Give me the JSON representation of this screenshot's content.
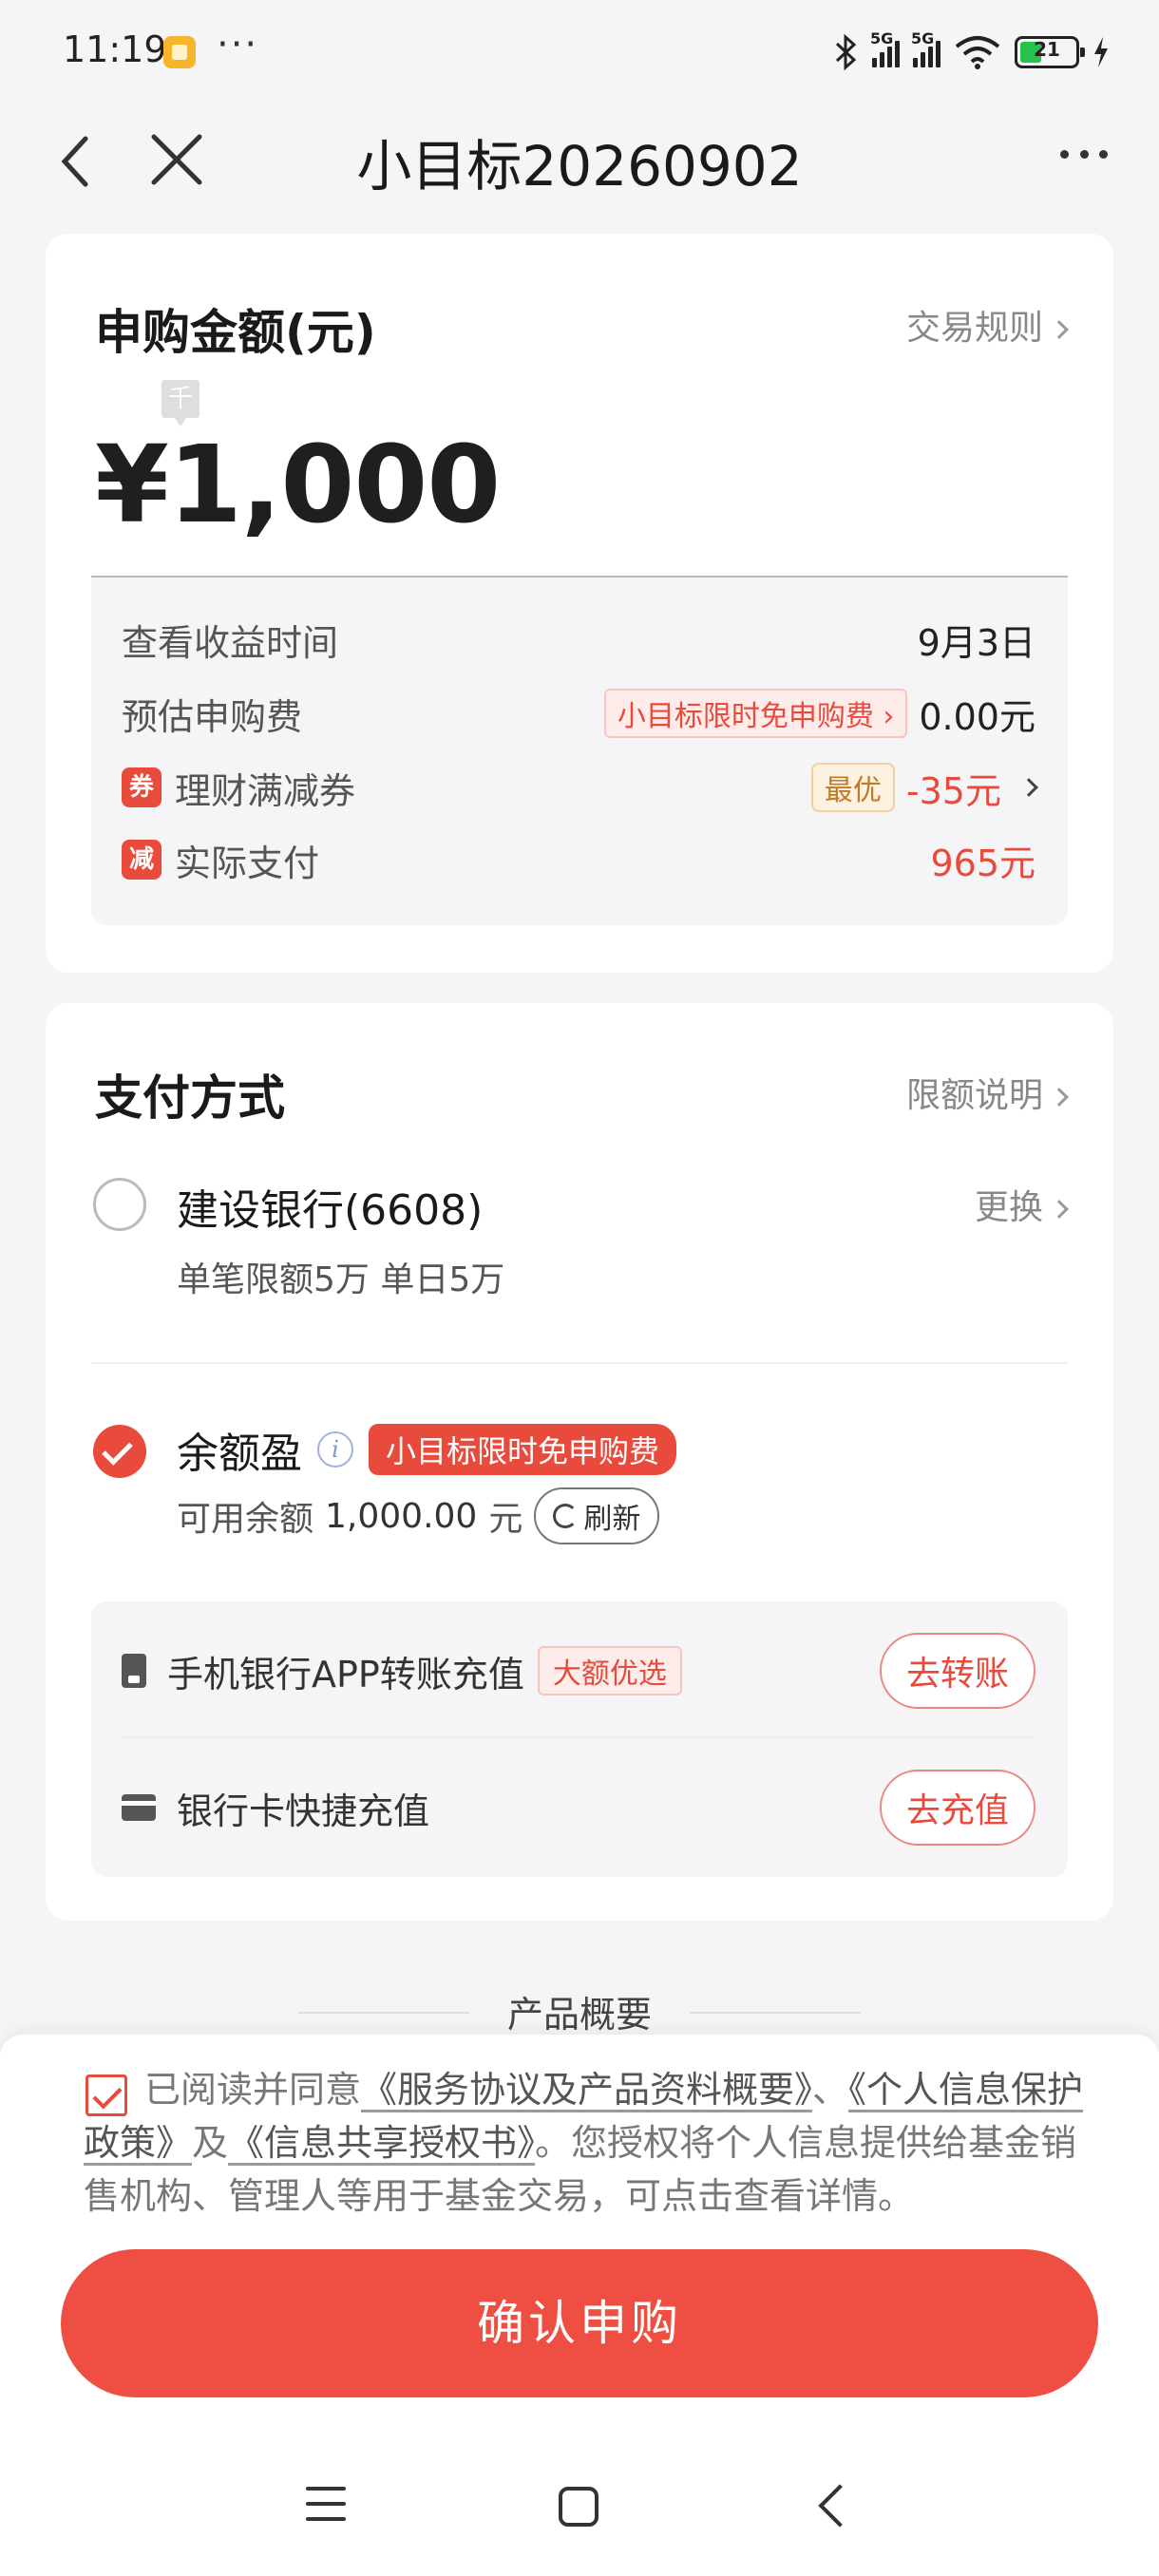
{
  "status_bar": {
    "time": "11:19",
    "more_dots": "···",
    "network_1": "5G",
    "network_2": "5G",
    "battery": "21",
    "icons": [
      "app-notification-icon",
      "bluetooth-icon",
      "signal-icon",
      "wifi-icon",
      "battery-icon",
      "charging-icon"
    ]
  },
  "nav": {
    "title": "小目标20260902",
    "back_icon": "chevron-left-icon",
    "close_icon": "close-icon",
    "more_icon": "more-icon"
  },
  "amount_card": {
    "title": "申购金额(元)",
    "rules_link": "交易规则",
    "unit_hint": "千",
    "currency": "¥",
    "amount": "1,000",
    "rows": {
      "earnings_time_label": "查看收益时间",
      "earnings_time_value": "9月3日",
      "fee_label": "预估申购费",
      "fee_promo": "小目标限时免申购费",
      "fee_value": "0.00元",
      "coupon_badge": "券",
      "coupon_label": "理财满减券",
      "coupon_tag": "最优",
      "coupon_value": "-35元",
      "pay_badge": "减",
      "pay_label": "实际支付",
      "pay_value": "965元"
    }
  },
  "payment_card": {
    "title": "支付方式",
    "limit_link": "限额说明",
    "bank": {
      "name": "建设银行(6608)",
      "limit": "单笔限额5万 单日5万",
      "change_link": "更换",
      "selected": false
    },
    "balance": {
      "name": "余额盈",
      "info_icon": "i",
      "promo": "小目标限时免申购费",
      "available_label": "可用余额",
      "available_value": "1,000.00",
      "available_unit": "元",
      "refresh": "刷新",
      "selected": true
    },
    "recharge": [
      {
        "label": "手机银行APP转账充值",
        "tag": "大额优选",
        "button": "去转账",
        "icon": "phone-icon"
      },
      {
        "label": "银行卡快捷充值",
        "tag": "",
        "button": "去充值",
        "icon": "bank-card-icon"
      }
    ]
  },
  "overview": {
    "label": "产品概要"
  },
  "agreement": {
    "prefix": "已阅读并同意",
    "link_1": "《服务协议及产品资料概要》",
    "sep": "、",
    "link_2": "《个人信息保护政策》",
    "and": "及",
    "link_3": "《信息共享授权书》",
    "suffix": "。您授权将个人信息提供给基金销售机构、管理人等用于基金交易，可点击查看详情。",
    "checked": true
  },
  "confirm_button": "确认申购",
  "colors": {
    "accent": "#e84a3c",
    "button": "#ef4f43",
    "background": "#f5f5f7",
    "battery_fill": "#27c24c"
  }
}
